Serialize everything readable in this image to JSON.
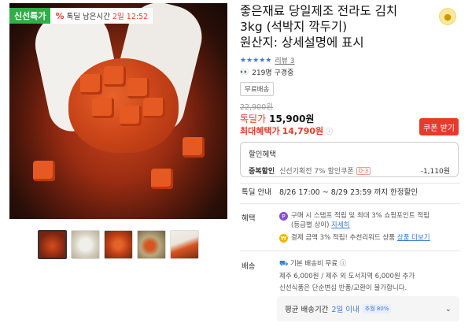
{
  "badge": {
    "label": "신선특가",
    "deal_icon": "%",
    "countdown_prefix": "톡딜 남은시간",
    "countdown_value": "2일 12:52"
  },
  "product": {
    "title_line1": "좋은재료 당일제조 전라도 김치",
    "title_line2": "3kg (석박지 깍두기)",
    "title_line3": "원산지: 상세설명에 표시",
    "share_icon": "coin-icon"
  },
  "rating": {
    "stars": "★★★★★",
    "review_label": "리뷰 3"
  },
  "purchase": {
    "eyes_icon": "eyes-icon",
    "text": "219명 구경중"
  },
  "shipping_tag": "무료배송",
  "price": {
    "original": "22,900원",
    "deal_label": "톡딜가",
    "deal_price": "15,900원",
    "max_label": "최대혜택가",
    "max_price": "14,790원",
    "info_glyph": "ⓘ",
    "coupon_button": "쿠폰 받기"
  },
  "promo": {
    "title": "할인혜택",
    "line_key": "중복할인",
    "line_desc": "신선기획전 7% 할인쿠폰",
    "line_chip": "D-3",
    "line_amount": "-1,110원"
  },
  "deal_guide": {
    "label": "톡딜 안내",
    "text": "8/26 17:00 ~ 8/29 23:59 까지 한정할인"
  },
  "benefit": {
    "label": "혜택",
    "line1": "구매 시 스탬프 적립 및 최대 3% 쇼핑포인트 적립",
    "line1b": "(등급별 상이)",
    "line1_link": "자세히",
    "line2": "결제 금액 3% 적립! 추천리워드 상품",
    "line2_link": "상품 더보기",
    "coin1": "P",
    "coin2": "₩"
  },
  "delivery": {
    "label": "배송",
    "truck_glyph": "⛟",
    "line1": "기본 배송비 무료",
    "line1_info": "ⓘ",
    "line2": "제주 6,000원 / 제주 외 도서지역 6,000원 추가",
    "line3": "신선식품은 단순변심 반품/교환이 불가합니다.",
    "avg_label": "평균 배송기간",
    "avg_value": "2일 이내",
    "avg_chip": "추월 80%",
    "chevron": "⌄"
  },
  "thumbnails": [
    "t1",
    "t2",
    "t3",
    "t4",
    "t5"
  ]
}
